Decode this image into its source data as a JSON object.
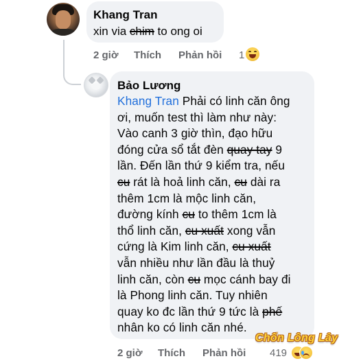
{
  "comment": {
    "author": "Khang Tran",
    "text_before": "xin via ",
    "text_struck": "chim",
    "text_after": " to ong oi",
    "time": "2 giờ",
    "like_label": "Thích",
    "reply_label": "Phản hồi",
    "reaction_count": "1",
    "reaction_icon": "laugh-emoji-icon"
  },
  "reply": {
    "author": "Bảo Lương",
    "mention": "Khang Tran",
    "lines": [
      [
        {
          "t": "Khang Tran",
          "m": true
        },
        {
          "t": " Phải có linh căn ông"
        }
      ],
      [
        {
          "t": "ơi, muốn test thì làm như này:"
        }
      ],
      [
        {
          "t": "Vào canh 3 giờ thìn, đạo hữu"
        }
      ],
      [
        {
          "t": "đóng cửa sổ tắt đèn "
        },
        {
          "t": "quay tay",
          "s": true
        },
        {
          "t": " 9"
        }
      ],
      [
        {
          "t": "lần. Đến lần thứ 9 kiểm tra, nếu"
        }
      ],
      [
        {
          "t": "cu",
          "s": true
        },
        {
          "t": " rát là hoả linh căn, "
        },
        {
          "t": "cu",
          "s": true
        },
        {
          "t": " dài ra"
        }
      ],
      [
        {
          "t": "thêm 1cm là mộc linh căn,"
        }
      ],
      [
        {
          "t": "đường kính "
        },
        {
          "t": "cu",
          "s": true
        },
        {
          "t": " to thêm 1cm là"
        }
      ],
      [
        {
          "t": "thổ linh căn, "
        },
        {
          "t": "cu xuất",
          "s": true
        },
        {
          "t": " xong vẫn"
        }
      ],
      [
        {
          "t": "cứng là Kim linh căn, "
        },
        {
          "t": "cu xuất",
          "s": true
        }
      ],
      [
        {
          "t": "vẫn nhiều như lần đầu là thuỷ"
        }
      ],
      [
        {
          "t": "linh căn, còn "
        },
        {
          "t": "cu",
          "s": true
        },
        {
          "t": " mọc cánh bay đi"
        }
      ],
      [
        {
          "t": "là Phong linh căn. Tuy nhiên"
        }
      ],
      [
        {
          "t": "quay ko đc lần thứ 9 tức là "
        },
        {
          "t": "phế",
          "s": true
        }
      ],
      [
        {
          "t": "nhân ko có linh căn nhé."
        }
      ]
    ],
    "time": "2 giờ",
    "like_label": "Thích",
    "reply_label": "Phản hồi",
    "reaction_count": "419",
    "reaction_icons": [
      "laugh-emoji-icon",
      "sad-emoji-icon"
    ]
  },
  "watermark": "Chốn Lông Lây",
  "colors": {
    "bubble": "#f0f2f5",
    "meta_text": "#65676b",
    "mention": "#216fdb",
    "watermark": "#ffd23a"
  }
}
